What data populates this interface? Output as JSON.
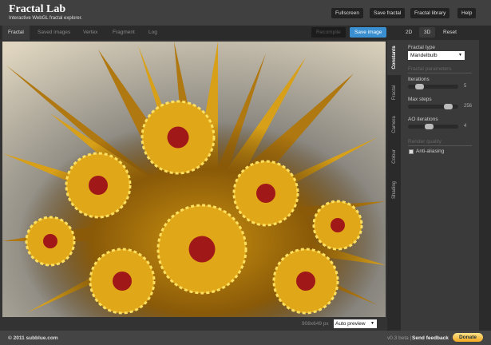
{
  "header": {
    "title": "Fractal Lab",
    "tagline": "Interactive WebGL fractal explorer.",
    "buttons": [
      "Fullscreen",
      "Save fractal",
      "Fractal library",
      "Help"
    ]
  },
  "tabs": [
    "Fractal",
    "Saved images",
    "Vertex",
    "Fragment",
    "Log"
  ],
  "toolbar": {
    "recompile": "Recompile",
    "save_image": "Save image",
    "mode_2d": "2D",
    "mode_3d": "3D",
    "reset": "Reset"
  },
  "canvas": {
    "size": "908x649 px",
    "preview": "Auto preview"
  },
  "side_tabs": [
    "Constants",
    "Fractal",
    "Camera",
    "Colour",
    "Shading"
  ],
  "panel": {
    "fractal_type_label": "Fractal type",
    "fractal_type": "Mandelbulb",
    "params_heading": "Fractal parameters",
    "sliders": [
      {
        "label": "Iterations",
        "value": "5",
        "fraction": 0.2
      },
      {
        "label": "Max steps",
        "value": "256",
        "fraction": 0.85
      },
      {
        "label": "AO iterations",
        "value": "4",
        "fraction": 0.45
      }
    ],
    "quality_heading": "Render quality",
    "antialias": "Anti-aliasing"
  },
  "footer": {
    "copyright": "© 2011 subblue.com",
    "version": "v0.3 beta |",
    "feedback": "Send feedback",
    "donate": "Donate"
  },
  "colors": {
    "accent": "#3a8fd0",
    "donate": "#f5c040"
  }
}
